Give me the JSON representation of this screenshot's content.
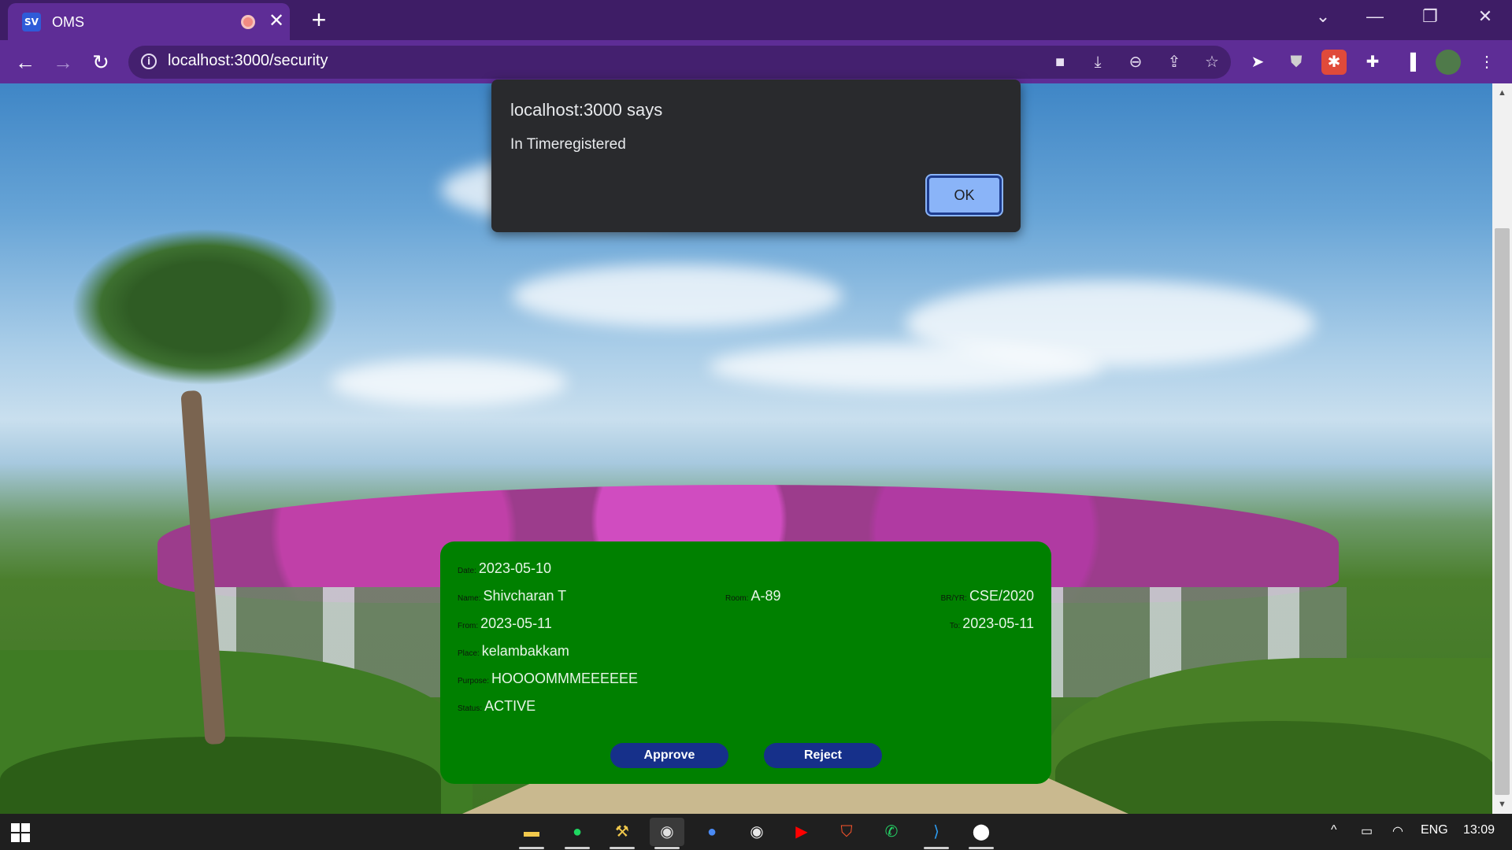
{
  "browser": {
    "tab_title": "OMS",
    "tab_favicon_text": "SV",
    "url": "localhost:3000/security",
    "icons": [
      "back-icon",
      "forward-icon",
      "reload-icon",
      "info-icon",
      "camera-icon",
      "install-icon",
      "zoom-out-icon",
      "share-icon",
      "star-icon",
      "cursor-extension-icon",
      "ublock-icon",
      "extension-red-icon",
      "puzzle-icon",
      "sidepanel-icon",
      "profile-avatar",
      "more-menu-icon"
    ]
  },
  "dialog": {
    "title": "localhost:3000 says",
    "message": "In Timeregistered",
    "ok_label": "OK"
  },
  "request": {
    "date_label": "Date:",
    "date_value": "2023-05-10",
    "name_label": "Name:",
    "name_value": "Shivcharan T",
    "room_label": "Room:",
    "room_value": "A-89",
    "bryr_label": "BR/YR:",
    "bryr_value": "CSE/2020",
    "from_label": "From:",
    "from_value": "2023-05-11",
    "to_label": "To:",
    "to_value": "2023-05-11",
    "place_label": "Place:",
    "place_value": "kelambakkam",
    "purpose_label": "Purpose:",
    "purpose_value": "HOOOOMMMEEEEEE",
    "status_label": "Status:",
    "status_value": "ACTIVE",
    "approve_label": "Approve",
    "reject_label": "Reject"
  },
  "taskbar": {
    "apps": [
      "file-explorer-icon",
      "spotify-icon",
      "app-icon",
      "chrome-icon",
      "spotify-web-icon",
      "chrome-icon-2",
      "youtube-icon",
      "brave-icon",
      "whatsapp-icon",
      "vscode-icon",
      "app-icon-2"
    ],
    "language": "ENG",
    "time": "13:09"
  },
  "colors": {
    "card_green": "#008000",
    "button_blue": "#16308a",
    "browser_purple": "#5e2d96",
    "dialog_bg": "#292a2d",
    "ok_button": "#8ab4f8"
  }
}
